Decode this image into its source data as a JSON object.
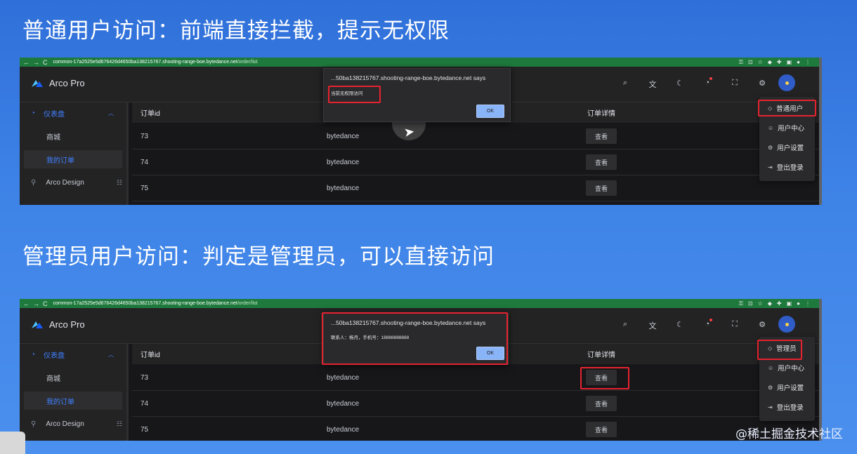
{
  "slide": {
    "heading1": "普通用户访问：前端直接拦截，提示无权限",
    "heading2": "管理员用户访问：判定是管理员，可以直接访问",
    "watermark": "@稀土掘金技术社区"
  },
  "browser": {
    "back": "←",
    "forward": "→",
    "reload": "C",
    "url_host": "common-17a2525e5d676426d4650ba138215767.shooting-range-boe.bytedance.net",
    "url_path": "/order/list",
    "icons": [
      "key-icon",
      "lock-icon",
      "star-icon",
      "extension-icon",
      "puzzle-icon",
      "sidebar-icon",
      "profile-icon",
      "menu-icon"
    ]
  },
  "app": {
    "brand": "Arco Pro",
    "header_icons": [
      "search-icon",
      "translate-icon",
      "moon-icon",
      "bell-icon",
      "fullscreen-icon",
      "gear-icon"
    ],
    "sidebar": {
      "dashboard": "仪表盘",
      "mall": "商城",
      "my_orders": "我的订单",
      "arco_design": "Arco Design"
    },
    "table": {
      "col_order_id": "订单id",
      "col_details": "订单详情",
      "view_label": "查看",
      "rows": [
        {
          "id": "73",
          "name": "bytedance"
        },
        {
          "id": "74",
          "name": "bytedance"
        },
        {
          "id": "75",
          "name": "bytedance"
        }
      ]
    }
  },
  "shot1": {
    "dialog_title": "...50ba138215767.shooting-range-boe.bytedance.net says",
    "dialog_message": "当前无权限访问",
    "ok_label": "OK",
    "menu_role": "普通用户",
    "menu_items": [
      "用户中心",
      "用户设置",
      "登出登录"
    ]
  },
  "shot2": {
    "dialog_title": "...50ba138215767.shooting-range-boe.bytedance.net says",
    "dialog_message": "联系人：杨月，手机号：18888888888",
    "ok_label": "OK",
    "menu_role": "管理员",
    "menu_items": [
      "用户中心",
      "用户设置",
      "登出登录"
    ]
  },
  "colors": {
    "background": "#3d82e6",
    "browser_bar": "#1e7a3c",
    "app_dark": "#17171a",
    "accent": "#4080ff",
    "highlight": "#e5232f"
  }
}
